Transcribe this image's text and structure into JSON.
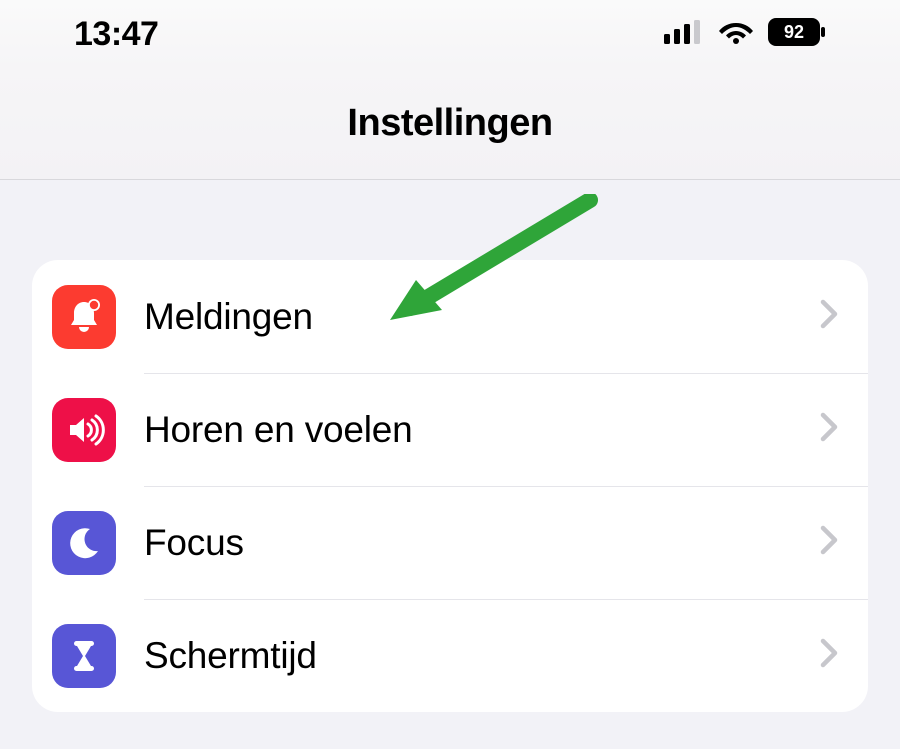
{
  "statusbar": {
    "time": "13:47",
    "battery_percent": "92"
  },
  "header": {
    "title": "Instellingen"
  },
  "settings": {
    "rows": [
      {
        "label": "Meldingen",
        "icon": "bell-badge-icon",
        "color": "#fc3b30"
      },
      {
        "label": "Horen en voelen",
        "icon": "speaker-icon",
        "color": "#ee1048"
      },
      {
        "label": "Focus",
        "icon": "moon-icon",
        "color": "#5856d6"
      },
      {
        "label": "Schermtijd",
        "icon": "hourglass-icon",
        "color": "#5856d6"
      }
    ]
  }
}
